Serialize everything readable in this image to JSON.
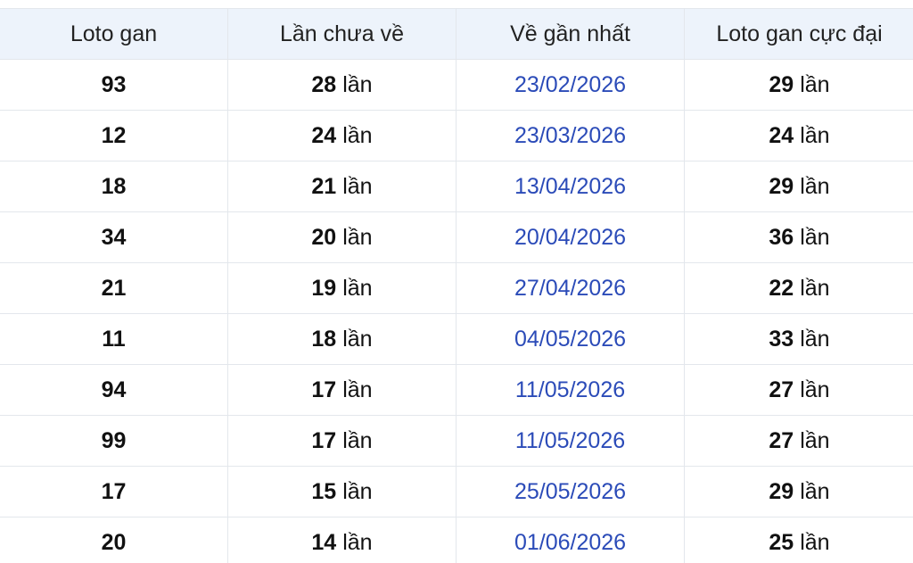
{
  "headers": [
    "Loto gan",
    "Lần chưa về",
    "Về gần nhất",
    "Loto gan cực đại"
  ],
  "unit": "lần",
  "rows": [
    {
      "loto": "93",
      "missing": "28",
      "last": "23/02/2026",
      "max": "29"
    },
    {
      "loto": "12",
      "missing": "24",
      "last": "23/03/2026",
      "max": "24"
    },
    {
      "loto": "18",
      "missing": "21",
      "last": "13/04/2026",
      "max": "29"
    },
    {
      "loto": "34",
      "missing": "20",
      "last": "20/04/2026",
      "max": "36"
    },
    {
      "loto": "21",
      "missing": "19",
      "last": "27/04/2026",
      "max": "22"
    },
    {
      "loto": "11",
      "missing": "18",
      "last": "04/05/2026",
      "max": "33"
    },
    {
      "loto": "94",
      "missing": "17",
      "last": "11/05/2026",
      "max": "27"
    },
    {
      "loto": "99",
      "missing": "17",
      "last": "11/05/2026",
      "max": "27"
    },
    {
      "loto": "17",
      "missing": "15",
      "last": "25/05/2026",
      "max": "29"
    },
    {
      "loto": "20",
      "missing": "14",
      "last": "01/06/2026",
      "max": "25"
    }
  ],
  "colors": {
    "header_bg": "#edf3fb",
    "date": "#2b4bb8",
    "border": "#e3e7ec"
  }
}
